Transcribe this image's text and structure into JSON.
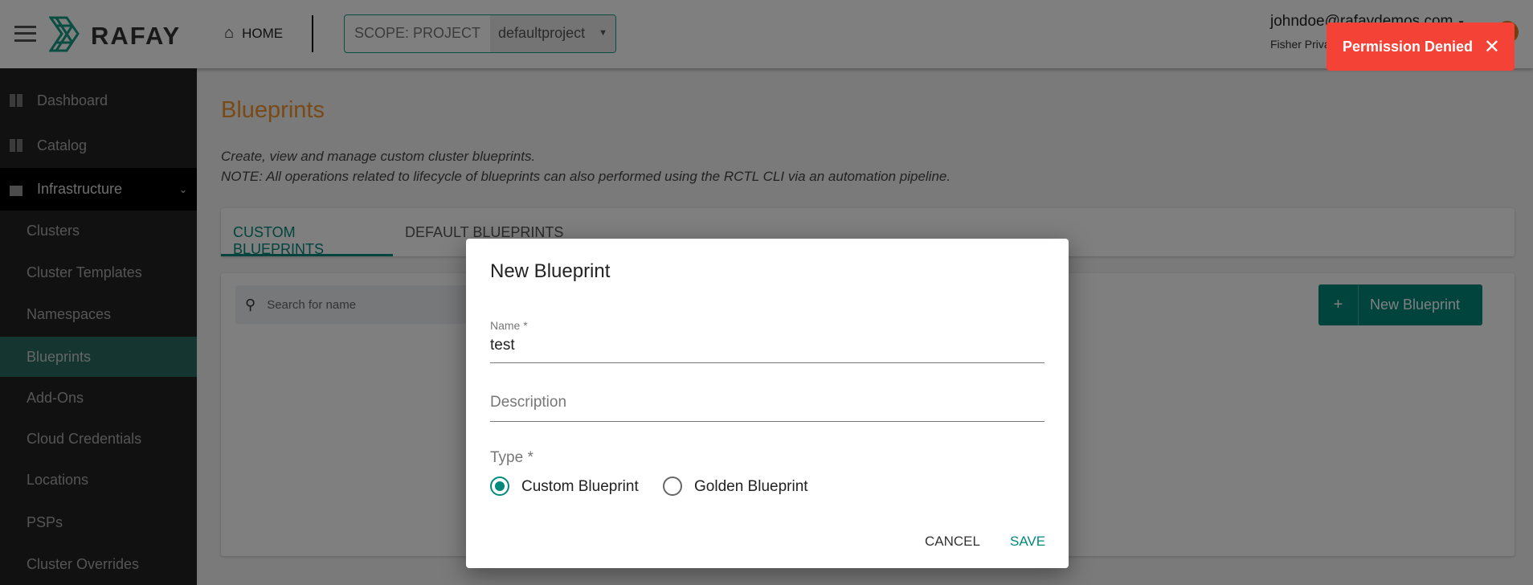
{
  "header": {
    "brand": "RAFAY",
    "home_label": "HOME",
    "scope_label": "SCOPE: PROJECT",
    "project": "defaultproject",
    "user_email": "johndoe@rafaydemos.com",
    "org": "Fisher Private"
  },
  "sidebar": {
    "items": [
      {
        "label": "Dashboard",
        "icon": "dashboard-icon"
      },
      {
        "label": "Catalog",
        "icon": "catalog-icon"
      },
      {
        "label": "Infrastructure",
        "icon": "infrastructure-icon"
      },
      {
        "label": "Clusters"
      },
      {
        "label": "Cluster Templates"
      },
      {
        "label": "Namespaces"
      },
      {
        "label": "Blueprints"
      },
      {
        "label": "Add-Ons"
      },
      {
        "label": "Cloud Credentials"
      },
      {
        "label": "Locations"
      },
      {
        "label": "PSPs"
      },
      {
        "label": "Cluster Overrides"
      }
    ]
  },
  "page": {
    "title": "Blueprints",
    "desc1": "Create, view and manage custom cluster blueprints.",
    "desc2": "NOTE: All operations related to lifecycle of blueprints can also performed using the RCTL CLI via an automation pipeline.",
    "tabs": [
      {
        "label": "CUSTOM BLUEPRINTS"
      },
      {
        "label": "DEFAULT BLUEPRINTS"
      }
    ],
    "search_placeholder": "Search for name",
    "new_button": "New Blueprint"
  },
  "modal": {
    "title": "New Blueprint",
    "name_label": "Name *",
    "name_value": "test",
    "description_placeholder": "Description",
    "type_label": "Type *",
    "options": [
      {
        "label": "Custom Blueprint",
        "selected": true
      },
      {
        "label": "Golden Blueprint",
        "selected": false
      }
    ],
    "cancel": "CANCEL",
    "save": "SAVE"
  },
  "toast": {
    "message": "Permission Denied",
    "color": "#f44336"
  },
  "colors": {
    "accent": "#00897b",
    "title": "#f0952b"
  }
}
